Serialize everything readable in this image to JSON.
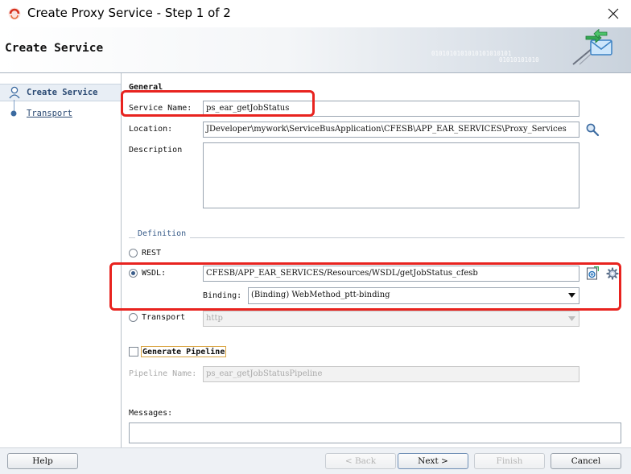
{
  "window": {
    "title": "Create Proxy Service - Step 1 of 2"
  },
  "header": {
    "title": "Create Service",
    "binary_1": "0101010101010101010101",
    "binary_2": "01010101010"
  },
  "nav": {
    "items": [
      {
        "label": "Create Service"
      },
      {
        "label": "Transport"
      }
    ]
  },
  "general": {
    "heading": "General",
    "service_name_label": "Service Name:",
    "service_name_value": "ps_ear_getJobStatus",
    "location_label": "Location:",
    "location_value": "JDeveloper\\mywork\\ServiceBusApplication\\CFESB\\APP_EAR_SERVICES\\Proxy_Services",
    "description_label": "Description",
    "description_value": ""
  },
  "definition": {
    "heading": "Definition",
    "rest_label": "REST",
    "wsdl_label": "WSDL:",
    "wsdl_value": "CFESB/APP_EAR_SERVICES/Resources/WSDL/getJobStatus_cfesb",
    "binding_label": "Binding:",
    "binding_value": "(Binding) WebMethod_ptt-binding",
    "transport_label": "Transport",
    "transport_value": "http",
    "selected": "WSDL"
  },
  "pipeline": {
    "generate_label": "Generate Pipeline",
    "generate_checked": false,
    "name_label": "Pipeline Name:",
    "name_value": "ps_ear_getJobStatusPipeline"
  },
  "messages": {
    "label": "Messages:",
    "value": ""
  },
  "buttons": {
    "help": "Help",
    "back": "< Back",
    "next": "Next >",
    "finish": "Finish",
    "cancel": "Cancel"
  },
  "colors": {
    "highlight": "#e8231f",
    "accent": "#3a5d8a"
  }
}
